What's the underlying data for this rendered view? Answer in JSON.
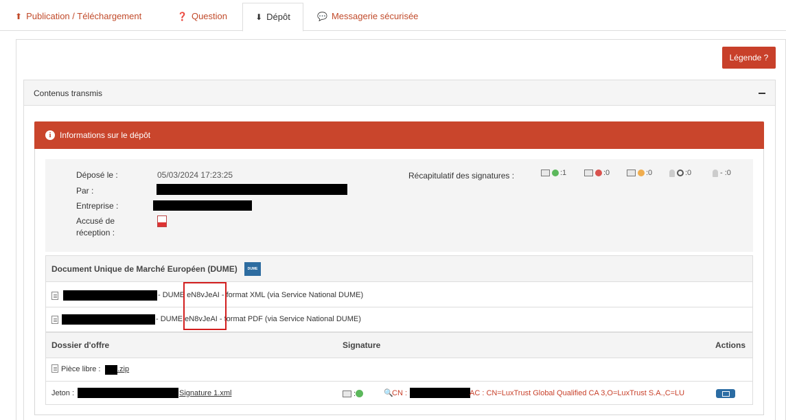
{
  "tabs": [
    {
      "label": "Publication / Téléchargement",
      "icon": "upload-icon"
    },
    {
      "label": "Question",
      "icon": "question-circle-icon"
    },
    {
      "label": "Dépôt",
      "icon": "download-icon",
      "active": true
    },
    {
      "label": "Messagerie sécurisée",
      "icon": "chat-bubbles-icon"
    }
  ],
  "legende_label": "Légende ?",
  "contenus": {
    "title": "Contenus transmis",
    "collapse": "−"
  },
  "info": {
    "title": "Informations sur le dépôt",
    "depose_label": "Déposé le :",
    "depose_value": "05/03/2024 17:23:25",
    "par_label": "Par :",
    "entreprise_label": "Entreprise :",
    "accuse_label_1": "Accusé de",
    "accuse_label_2": "réception :",
    "recap_label": "Récapitulatif des signatures :",
    "recap": [
      {
        "status": "valid",
        "count": ":1",
        "color": "#5cb85c"
      },
      {
        "status": "invalid",
        "count": ":0",
        "color": "#d9534f"
      },
      {
        "status": "warning",
        "count": ":0",
        "color": "#f0ad4e"
      },
      {
        "status": "none",
        "count": ":0"
      },
      {
        "status": "unknown",
        "count": "- :0"
      }
    ]
  },
  "dume": {
    "title": "Document Unique de Marché Européen (DUME)",
    "logo_text": "DUME",
    "row1": "- DUME eN8vJeAI - format XML (via Service National DUME)",
    "row2": "- DUME eN8vJeAI - format PDF (via Service National DUME)"
  },
  "dossier": {
    "col_dossier": "Dossier d'offre",
    "col_signature": "Signature",
    "col_actions": "Actions",
    "piece_label": "Pièce libre :",
    "piece_ext": ".zip",
    "jeton_label": "Jeton :",
    "jeton_file": "Signature 1.xml",
    "cn_prefix": "CN :",
    "cn_suffix": "AC : CN=LuxTrust Global Qualified CA 3,O=LuxTrust S.A.,C=LU",
    "sig_sep": ":"
  },
  "colors": {
    "accent": "#c9452c",
    "link": "#c14a2a",
    "valid": "#5cb85c"
  }
}
